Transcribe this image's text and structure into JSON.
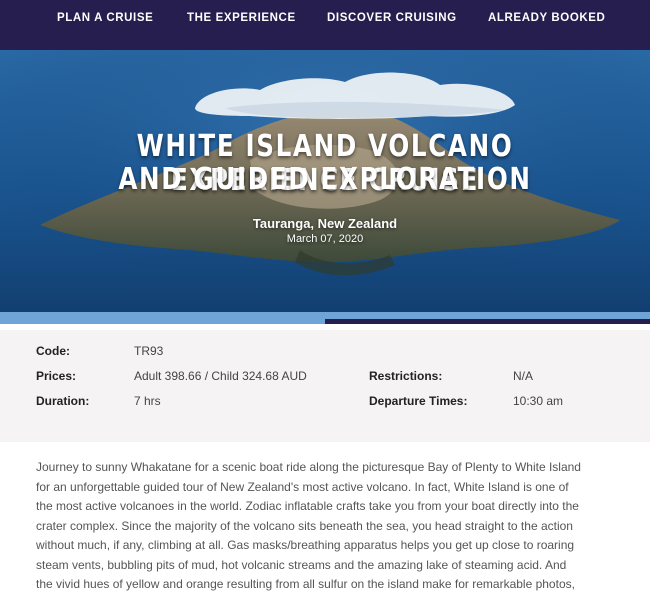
{
  "nav": {
    "items": [
      "PLAN A CRUISE",
      "THE EXPERIENCE",
      "DISCOVER CRUISING",
      "ALREADY BOOKED"
    ]
  },
  "hero": {
    "title_line1": "WHITE ISLAND VOLCANO EXPERIENCE CRUISE",
    "title_line2": "AND GUIDED EXPLORATION",
    "location": "Tauranga, New Zealand",
    "date": "March 07, 2020"
  },
  "progress": {
    "filled_fraction": 0.5
  },
  "details": {
    "code_label": "Code:",
    "code_value": "TR93",
    "prices_label": "Prices:",
    "prices_value": "Adult 398.66 / Child 324.68 AUD",
    "duration_label": "Duration:",
    "duration_value": "7 hrs",
    "restrictions_label": "Restrictions:",
    "restrictions_value": "N/A",
    "departure_label": "Departure Times:",
    "departure_value": "10:30 am"
  },
  "description": {
    "lines": [
      "Journey to sunny Whakatane for a scenic boat ride along the picturesque Bay of Plenty to White Island",
      "for an unforgettable guided tour of New Zealand's most active volcano. In fact, White Island is one of",
      "the most active volcanoes in the world. Zodiac inflatable crafts take you from your boat directly into the",
      "crater complex. Since the majority of the volcano sits beneath the sea, you head straight to the action",
      "without much, if any, climbing at all. Gas masks/breathing apparatus helps you get up close to roaring",
      "steam vents, bubbling pits of mud, hot volcanic streams and the amazing lake of steaming acid. And",
      "the vivid hues of yellow and orange resulting from all sulfur on the island make for remarkable photos,"
    ]
  },
  "colors": {
    "nav_bg": "#251e4e",
    "strip_light": "#6fa4d6",
    "strip_dark": "#251e4e",
    "details_bg": "#f5f3f3"
  }
}
